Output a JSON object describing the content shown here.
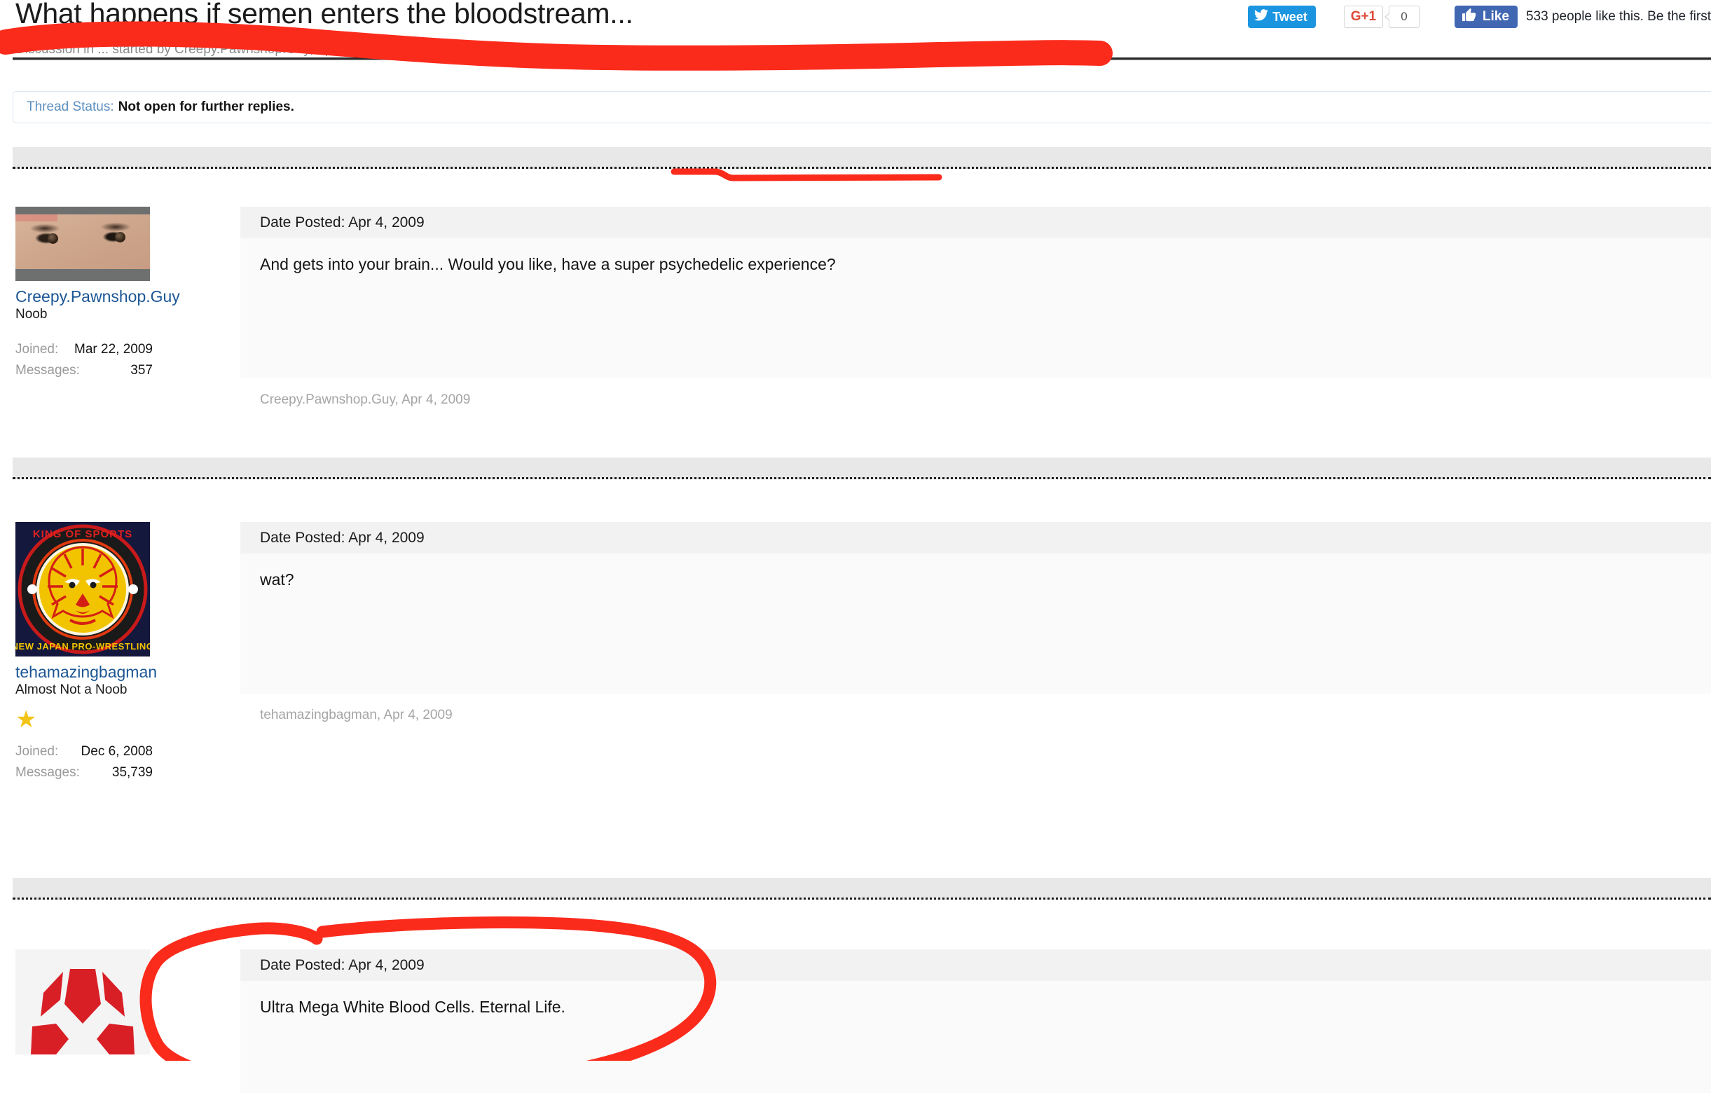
{
  "header": {
    "title": "What happens if semen enters the bloodstream...",
    "subtitle": "Discussion in ... started by Creepy.Pawnshop.Guy, Apr 4, 2009.",
    "social": {
      "tweet_label": "Tweet",
      "gplus_label": "G+1",
      "gplus_count": "0",
      "like_label": "Like",
      "fb_text": "533 people like this. Be the first"
    }
  },
  "thread_status": {
    "label": "Thread Status:",
    "value": "Not open for further replies."
  },
  "labels": {
    "joined": "Joined:",
    "messages": "Messages:",
    "date_posted_prefix": "Date Posted:"
  },
  "posts": [
    {
      "username": "Creepy.Pawnshop.Guy",
      "usertitle": "Noob",
      "joined": "Mar 22, 2009",
      "messages": "357",
      "date_posted": "Date Posted: Apr 4, 2009",
      "message": "And gets into your brain... Would you like, have a super psychedelic experience?",
      "footer": "Creepy.Pawnshop.Guy, Apr 4, 2009",
      "avatar_kind": "face-photo-avatar",
      "badge": ""
    },
    {
      "username": "tehamazingbagman",
      "usertitle": "Almost Not a Noob",
      "joined": "Dec 6, 2008",
      "messages": "35,739",
      "date_posted": "Date Posted: Apr 4, 2009",
      "message": "wat?",
      "footer": "tehamazingbagman, Apr 4, 2009",
      "avatar_kind": "njpw-lion-logo-avatar",
      "badge": "★"
    },
    {
      "username": "",
      "usertitle": "",
      "joined": "",
      "messages": "",
      "date_posted": "Date Posted: Apr 4, 2009",
      "message": "Ultra Mega White Blood Cells. Eternal Life.",
      "footer": "",
      "avatar_kind": "red-polygon-logo-avatar",
      "badge": ""
    }
  ],
  "annotations": {
    "color": "#fb2b1c",
    "marks": [
      "title-strikethrough-scribble",
      "underline-super-psychedelic-experience",
      "circle-around-third-post"
    ]
  },
  "colors": {
    "link": "#1c5694",
    "twitter_blue": "#1b95e0",
    "facebook_blue": "#4267b2",
    "gplus_red": "#dd4b39",
    "post_head_bg": "#f2f2f2",
    "post_body_bg": "#fafafa",
    "separator_bg": "#e8e8e8",
    "annotation_red": "#fb2b1c"
  }
}
